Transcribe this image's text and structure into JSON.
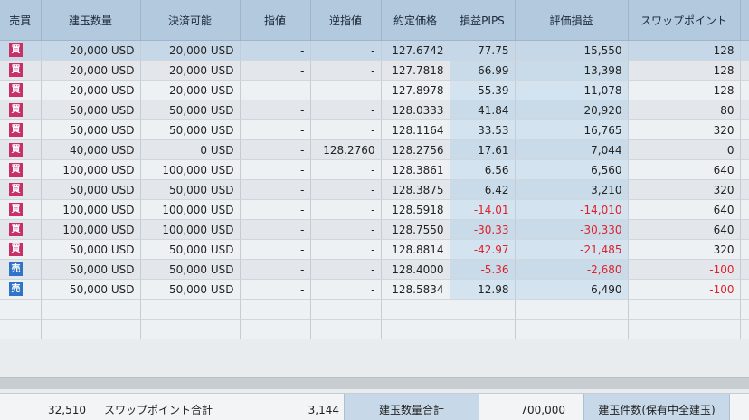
{
  "columns": {
    "side": "売買",
    "amount": "建玉数量",
    "available": "決済可能",
    "limit": "指値",
    "stop": "逆指値",
    "price": "約定価格",
    "pips": "損益PIPS",
    "pl": "評価損益",
    "swap": "スワップポイント"
  },
  "rows": [
    {
      "side": "買",
      "side_type": "buy",
      "amount": "20,000 USD",
      "available": "20,000 USD",
      "limit": "-",
      "stop": "-",
      "price": "127.6742",
      "pips": "77.75",
      "pl": "15,550",
      "swap": "128"
    },
    {
      "side": "買",
      "side_type": "buy",
      "amount": "20,000 USD",
      "available": "20,000 USD",
      "limit": "-",
      "stop": "-",
      "price": "127.7818",
      "pips": "66.99",
      "pl": "13,398",
      "swap": "128"
    },
    {
      "side": "買",
      "side_type": "buy",
      "amount": "20,000 USD",
      "available": "20,000 USD",
      "limit": "-",
      "stop": "-",
      "price": "127.8978",
      "pips": "55.39",
      "pl": "11,078",
      "swap": "128"
    },
    {
      "side": "買",
      "side_type": "buy",
      "amount": "50,000 USD",
      "available": "50,000 USD",
      "limit": "-",
      "stop": "-",
      "price": "128.0333",
      "pips": "41.84",
      "pl": "20,920",
      "swap": "80"
    },
    {
      "side": "買",
      "side_type": "buy",
      "amount": "50,000 USD",
      "available": "50,000 USD",
      "limit": "-",
      "stop": "-",
      "price": "128.1164",
      "pips": "33.53",
      "pl": "16,765",
      "swap": "320"
    },
    {
      "side": "買",
      "side_type": "buy",
      "amount": "40,000 USD",
      "available": "0 USD",
      "limit": "-",
      "stop": "128.2760",
      "price": "128.2756",
      "pips": "17.61",
      "pl": "7,044",
      "swap": "0"
    },
    {
      "side": "買",
      "side_type": "buy",
      "amount": "100,000 USD",
      "available": "100,000 USD",
      "limit": "-",
      "stop": "-",
      "price": "128.3861",
      "pips": "6.56",
      "pl": "6,560",
      "swap": "640"
    },
    {
      "side": "買",
      "side_type": "buy",
      "amount": "50,000 USD",
      "available": "50,000 USD",
      "limit": "-",
      "stop": "-",
      "price": "128.3875",
      "pips": "6.42",
      "pl": "3,210",
      "swap": "320"
    },
    {
      "side": "買",
      "side_type": "buy",
      "amount": "100,000 USD",
      "available": "100,000 USD",
      "limit": "-",
      "stop": "-",
      "price": "128.5918",
      "pips": "-14.01",
      "pl": "-14,010",
      "swap": "640"
    },
    {
      "side": "買",
      "side_type": "buy",
      "amount": "100,000 USD",
      "available": "100,000 USD",
      "limit": "-",
      "stop": "-",
      "price": "128.7550",
      "pips": "-30.33",
      "pl": "-30,330",
      "swap": "640"
    },
    {
      "side": "買",
      "side_type": "buy",
      "amount": "50,000 USD",
      "available": "50,000 USD",
      "limit": "-",
      "stop": "-",
      "price": "128.8814",
      "pips": "-42.97",
      "pl": "-21,485",
      "swap": "320"
    },
    {
      "side": "売",
      "side_type": "sell",
      "amount": "50,000 USD",
      "available": "50,000 USD",
      "limit": "-",
      "stop": "-",
      "price": "128.4000",
      "pips": "-5.36",
      "pl": "-2,680",
      "swap": "-100"
    },
    {
      "side": "売",
      "side_type": "sell",
      "amount": "50,000 USD",
      "available": "50,000 USD",
      "limit": "-",
      "stop": "-",
      "price": "128.5834",
      "pips": "12.98",
      "pl": "6,490",
      "swap": "-100"
    }
  ],
  "colors": {
    "buy": "#c8306a",
    "sell": "#2f74c6",
    "negative": "#e0202a",
    "header": "#b3c9de"
  },
  "footer": {
    "pl_total": "32,510",
    "swap_label": "スワップポイント合計",
    "swap_total": "3,144",
    "amount_label": "建玉数量合計",
    "amount_total": "700,000",
    "count_label": "建玉件数(保有中全建玉)"
  }
}
